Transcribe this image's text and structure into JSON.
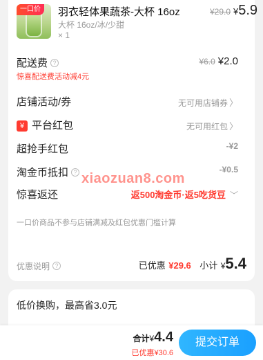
{
  "product": {
    "badge": "一口价",
    "title": "羽衣轻体果蔬茶-大杯 16oz",
    "spec": "大杯 16oz/冰/少甜",
    "qty": "× 1",
    "orig_price": "¥29.0",
    "price_yen": "¥",
    "price": "5.9"
  },
  "shipping": {
    "label": "配送费",
    "orig": "¥6.0",
    "value": "¥2.0",
    "promo": "惊喜配送费活动减4元"
  },
  "store_activity": {
    "label": "店铺活动/券",
    "value": "无可用店铺券"
  },
  "platform_packet": {
    "badge": "¥",
    "label": "平台红包",
    "value": "无可用红包"
  },
  "super_packet": {
    "label": "超抢手红包",
    "value": "-¥2"
  },
  "taojinbi": {
    "label": "淘金币抵扣",
    "value": "-¥0.5"
  },
  "surprise": {
    "label": "惊喜返还",
    "value": "返500淘金币·返5吃货豆"
  },
  "notice": "一口价商品不参与店铺满减及红包优惠门槛计算",
  "watermark": "xiaozuan8.com",
  "summary": {
    "label": "优惠说明",
    "discount_label": "已优惠",
    "discount_value": "¥29.6",
    "subtotal_label": "小计",
    "subtotal_yen": "¥",
    "subtotal_value": "5.4"
  },
  "upgrade": {
    "text": "低价换购，最高省3.0元"
  },
  "bottom": {
    "total_label": "合计",
    "total_yen": "¥",
    "total_value": "4.4",
    "saved": "已优惠¥30.6",
    "submit": "提交订单"
  },
  "icons": {
    "help": "help-circle-icon",
    "chevron": "chevron-right-icon",
    "chevron_down": "chevron-down-icon",
    "yen": "yen-badge-icon"
  },
  "colors": {
    "accent_red": "#ff3b30",
    "submit_blue": "#1aa0ff"
  }
}
